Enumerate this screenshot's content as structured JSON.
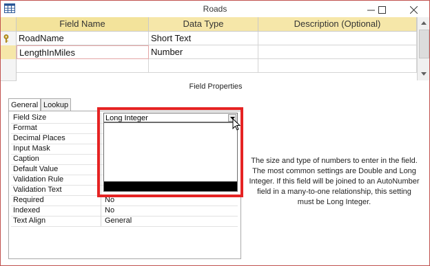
{
  "window": {
    "title": "Roads"
  },
  "design_grid": {
    "columns": [
      "Field Name",
      "Data Type",
      "Description (Optional)"
    ],
    "rows": [
      {
        "field_name": "RoadName",
        "data_type": "Short Text",
        "description": "",
        "primary_key": true
      },
      {
        "field_name": "LengthInMiles",
        "data_type": "Number",
        "description": "",
        "primary_key": false
      }
    ]
  },
  "field_properties": {
    "title": "Field Properties",
    "tabs": [
      "General",
      "Lookup"
    ],
    "active_tab": "General",
    "properties": [
      {
        "name": "Field Size",
        "value": ""
      },
      {
        "name": "Format",
        "value": ""
      },
      {
        "name": "Decimal Places",
        "value": ""
      },
      {
        "name": "Input Mask",
        "value": ""
      },
      {
        "name": "Caption",
        "value": ""
      },
      {
        "name": "Default Value",
        "value": ""
      },
      {
        "name": "Validation Rule",
        "value": ""
      },
      {
        "name": "Validation Text",
        "value": ""
      },
      {
        "name": "Required",
        "value": "No"
      },
      {
        "name": "Indexed",
        "value": "No"
      },
      {
        "name": "Text Align",
        "value": "General"
      }
    ],
    "field_size_combo": {
      "value": "Long Integer"
    }
  },
  "help_text": "The size and type of numbers to enter in the field. The most common settings are Double and Long Integer. If this field will be joined to an AutoNumber field in a many-to-one relationship, this setting must be Long Integer.",
  "colors": {
    "highlight_box": "#e52323",
    "header_bg": "#f6e7a9",
    "key_icon": "#c9a227"
  }
}
